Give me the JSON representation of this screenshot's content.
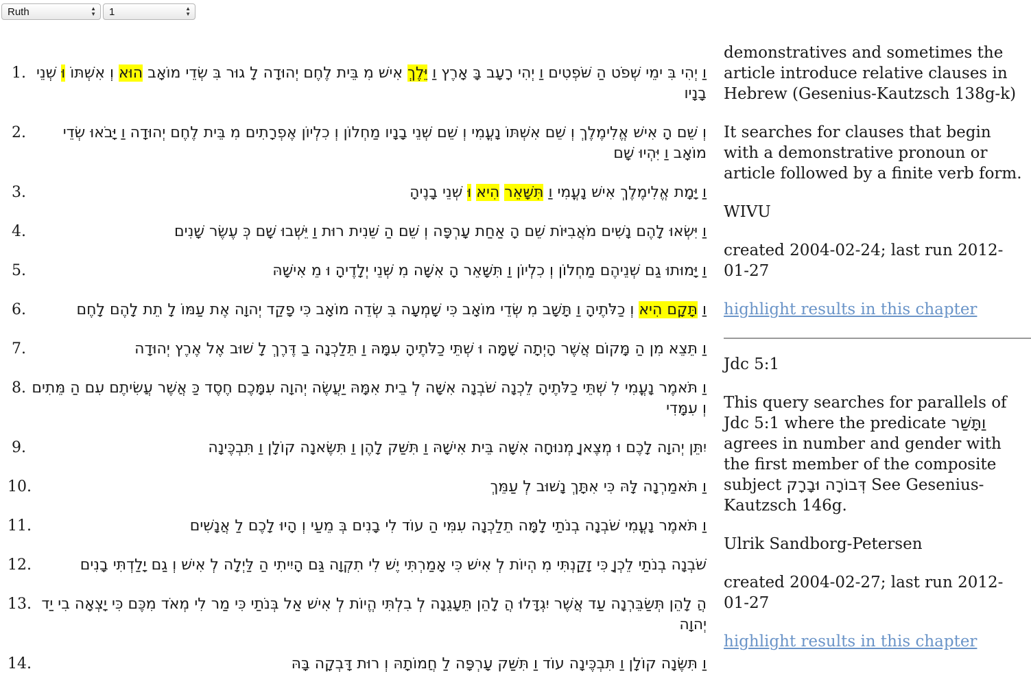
{
  "selectors": {
    "book": "Ruth",
    "chapter": "1"
  },
  "verses": [
    {
      "num": "1.",
      "segments": [
        {
          "text": "וַ יְהִי בִּ ימֵי שְׁפֹט הַ שֹּׁפְטִים וַ יְהִי רָעָב בָּ אָרֶץ וַ ",
          "hl": false
        },
        {
          "text": "יֵּלֶךְ",
          "hl": true
        },
        {
          "text": " אִישׁ מִ בֵּית לֶחֶם יְהוּדָה לָ גוּר בִּ שְׂדֵי מוֹאָב ",
          "hl": false
        },
        {
          "text": "הוּא",
          "hl": true
        },
        {
          "text": " וְ אִשְׁתּוֹ ",
          "hl": false
        },
        {
          "text": "וּ",
          "hl": true
        },
        {
          "text": " שְׁנֵי בָנָיו",
          "hl": false
        }
      ]
    },
    {
      "num": "2.",
      "segments": [
        {
          "text": "וְ שֵׁם הָ אִישׁ אֱלִימֶלֶךְ וְ שֵׁם אִשְׁתּוֹ נָעֳמִי וְ שֵׁם שְׁנֵי בָנָיו מַחְלוֹן וְ כִלְיוֹן אֶפְרָתִים מִ בֵּית לֶחֶם יְהוּדָה וַ יָּבֹאוּ שְׂדֵי מוֹאָב וַ יִּהְיוּ שָׁם",
          "hl": false
        }
      ]
    },
    {
      "num": "3.",
      "segments": [
        {
          "text": "וַ יָּמָת אֱלִימֶלֶךְ אִישׁ נָעֳמִי וַ ",
          "hl": false
        },
        {
          "text": "תִּשָּׁאֵר",
          "hl": true
        },
        {
          "text": " ",
          "hl": false
        },
        {
          "text": "הִיא",
          "hl": true
        },
        {
          "text": " ",
          "hl": false
        },
        {
          "text": "וּ",
          "hl": true
        },
        {
          "text": " שְׁנֵי בָנֶיהָ",
          "hl": false
        }
      ]
    },
    {
      "num": "4.",
      "segments": [
        {
          "text": "וַ יִּשְׂאוּ לָהֶם נָשִׁים מֹאֲבִיּוֹת שֵׁם הָ אַחַת עָרְפָּה וְ שֵׁם הַ שֵּׁנִית רוּת וַ יֵּשְׁבוּ שָׁם כְּ עֶשֶׂר שָׁנִים",
          "hl": false
        }
      ]
    },
    {
      "num": "5.",
      "segments": [
        {
          "text": "וַ יָּמוּתוּ גַם שְׁנֵיהֶם מַחְלוֹן וְ כִלְיוֹן וַ תִּשָּׁאֵר הָ אִשָּׁה מִ שְּׁנֵי יְלָדֶיהָ וּ מֵ אִישָׁהּ",
          "hl": false
        }
      ]
    },
    {
      "num": "6.",
      "segments": [
        {
          "text": "וַ ",
          "hl": false
        },
        {
          "text": "תָּקָם הִיא",
          "hl": true
        },
        {
          "text": " וְ כַלֹּתֶיהָ וַ תָּשָׁב מִ שְּׂדֵי מוֹאָב כִּי שָׁמְעָה בִּ שְׂדֵה מוֹאָב כִּי פָקַד יְהוָה אֶת עַמּוֹ לָ תֵת לָהֶם לָחֶם",
          "hl": false
        }
      ]
    },
    {
      "num": "7.",
      "segments": [
        {
          "text": "וַ תֵּצֵא מִן הַ מָּקוֹם אֲשֶׁר הָיְתָה שָׁמָּה וּ שְׁתֵּי כַלֹּתֶיהָ עִמָּהּ וַ תֵּלַכְנָה בַ דֶּרֶךְ לָ שׁוּב אֶל אֶרֶץ יְהוּדָה",
          "hl": false
        }
      ]
    },
    {
      "num": "8.",
      "segments": [
        {
          "text": "וַ תֹּאמֶר נָעֳמִי לִ שְׁתֵּי כַלֹּתֶיהָ לֵכְנָה שֹּׁבְנָה אִשָּׁה לְ בֵית אִמָּהּ יַעֲשֶׂה יְהוָה עִמָּכֶם חֶסֶד כַּ אֲשֶׁר עֲשִׂיתֶם עִם הַ מֵּתִים וְ עִמָּדִי",
          "hl": false
        }
      ]
    },
    {
      "num": "9.",
      "segments": [
        {
          "text": "יִתֵּן יְהוָה לָכֶם וּ מְצֶאןָ מְנוּחָה אִשָּׁה בֵּית אִישָׁהּ וַ תִּשַּׁק לָהֶן וַ תִּשֶּׂאנָה קוֹלָן וַ תִּבְכֶּינָה",
          "hl": false
        }
      ]
    },
    {
      "num": "10.",
      "segments": [
        {
          "text": "וַ תֹּאמַרְנָה לָּהּ כִּי אִתָּךְ נָשׁוּב לְ עַמֵּךְ",
          "hl": false
        }
      ]
    },
    {
      "num": "11.",
      "segments": [
        {
          "text": "וַ תֹּאמֶר נָעֳמִי שֹׁבְנָה בְנֹתַי לָמָּה תֵלַכְנָה עִמִּי הַ עוֹד לִי בָנִים בְּ מֵעַי וְ הָיוּ לָכֶם לַ אֲנָשִׁים",
          "hl": false
        }
      ]
    },
    {
      "num": "12.",
      "segments": [
        {
          "text": "שֹׁבְנָה בְנֹתַי לֵכְןָ כִּי זָקַנְתִּי מִ הְיוֹת לְ אִישׁ כִּי אָמַרְתִּי יֶשׁ לִי תִקְוָה גַּם הָיִיתִי הַ לַּיְלָה לְ אִישׁ וְ גַם יָלַדְתִּי בָנִים",
          "hl": false
        }
      ]
    },
    {
      "num": "13.",
      "segments": [
        {
          "text": "הֲ לָהֵן תְּשַׂבֵּרְנָה עַד אֲשֶׁר יִגְדָּלוּ הֲ לָהֵן תֵּעָגֵנָה לְ בִלְתִּי הֱיוֹת לְ אִישׁ אַל בְּנֹתַי כִּי מַר לִי מְאֹד מִכֶּם כִּי יָצְאָה בִי יַד יְהוָה",
          "hl": false
        }
      ]
    },
    {
      "num": "14.",
      "segments": [
        {
          "text": "וַ תִּשֶּׂנָה קוֹלָן וַ תִּבְכֶּינָה עוֹד וַ תִּשַּׁק עָרְפָּה לַ חֲמוֹתָהּ וְ רוּת דָּבְקָה בָּהּ",
          "hl": false
        }
      ]
    }
  ],
  "sidebar": {
    "query1": {
      "desc": "demonstratives and sometimes the article introduce relative clauses in Hebrew (Gesenius-Kautzsch 138g-k)",
      "explanation": "It searches for clauses that begin with a demonstrative pronoun or article followed by a finite verb form.",
      "author": "WIVU",
      "dates": "created 2004-02-24; last run 2012-01-27",
      "link": "highlight results in this chapter"
    },
    "query2": {
      "title": "Jdc 5:1",
      "desc_part1": "This query searches for parallels of Jdc 5:1 where the predicate ",
      "desc_heb1": "וַתָּשַׁר",
      "desc_part2": " agrees in number and gender with the first member of the composite subject ",
      "desc_heb2": "דְּבוֹרָה וּבָרָק",
      "desc_part3": " See Gesenius-Kautzsch 146g.",
      "author": "Ulrik Sandborg-Petersen",
      "dates": "created 2004-02-27; last run 2012-01-27",
      "link": "highlight results in this chapter"
    }
  }
}
